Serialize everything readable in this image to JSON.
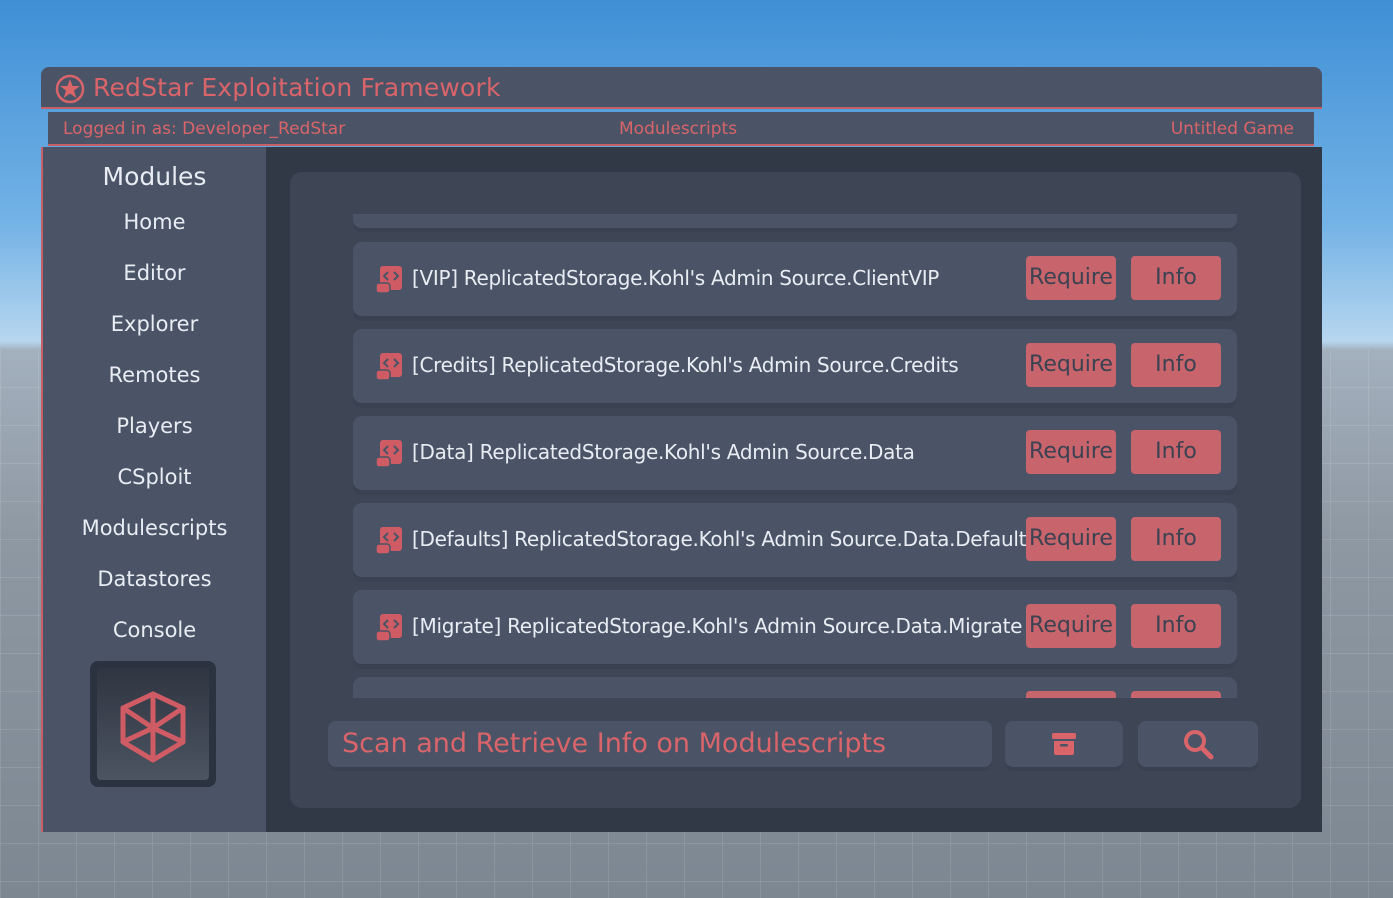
{
  "window": {
    "title": "RedStar Exploitation Framework",
    "logo_icon": "star-circle-icon"
  },
  "infobar": {
    "user": "Logged in as: Developer_RedStar",
    "current_page": "Modulescripts",
    "game": "Untitled Game"
  },
  "sidebar": {
    "heading": "Modules",
    "items": [
      {
        "label": "Home"
      },
      {
        "label": "Editor"
      },
      {
        "label": "Explorer"
      },
      {
        "label": "Remotes"
      },
      {
        "label": "Players"
      },
      {
        "label": "CSploit"
      },
      {
        "label": "Modulescripts"
      },
      {
        "label": "Datastores"
      },
      {
        "label": "Console"
      }
    ],
    "thumbnail_icon": "wireframe-cube-icon"
  },
  "modules": [
    {
      "label": "[VIP] ReplicatedStorage.Kohl's Admin Source.ClientVIP",
      "require": "Require",
      "info": "Info"
    },
    {
      "label": "[Credits] ReplicatedStorage.Kohl's Admin Source.Credits",
      "require": "Require",
      "info": "Info"
    },
    {
      "label": "[Data] ReplicatedStorage.Kohl's Admin Source.Data",
      "require": "Require",
      "info": "Info"
    },
    {
      "label": "[Defaults] ReplicatedStorage.Kohl's Admin Source.Data.Defaults",
      "require": "Require",
      "info": "Info"
    },
    {
      "label": "[Migrate] ReplicatedStorage.Kohl's Admin Source.Data.Migrate",
      "require": "Require",
      "info": "Info"
    },
    {
      "label": "",
      "require": "",
      "info": ""
    }
  ],
  "toolbar": {
    "search_text": "Scan and Retrieve Info on Modulescripts",
    "archive_icon": "archive-icon",
    "search_icon": "search-icon"
  },
  "colors": {
    "accent": "#d9646a",
    "button": "#c8646b",
    "panel": "#4a5466",
    "background": "#313846"
  }
}
